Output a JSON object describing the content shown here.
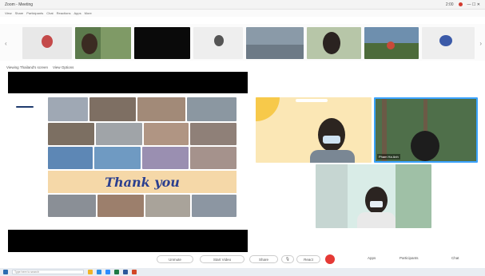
{
  "window": {
    "title": "Zoom - Meeting",
    "time": "2:00"
  },
  "menu": {
    "items": [
      "View",
      "Share",
      "Participants",
      "Chat",
      "Reactions",
      "Apps",
      "More"
    ]
  },
  "share": {
    "label": "Viewing Thailand's screen",
    "view_options": "View Options"
  },
  "slide": {
    "banner_text": "Thank you"
  },
  "videos": {
    "bottom_right_name": "Pham Ha Anh"
  },
  "controls": {
    "mute": "Unmute",
    "video": "Start Video",
    "share": "Share",
    "react": "React",
    "end": "End",
    "apps": "Apps",
    "participants": "Participants",
    "chat": "Chat"
  },
  "taskbar": {
    "search_placeholder": "Type here to search"
  },
  "colors": {
    "accent": "#3aa3ff",
    "end_red": "#e53935",
    "banner": "#f5d8a8",
    "thanks_text": "#2a3f8f"
  }
}
